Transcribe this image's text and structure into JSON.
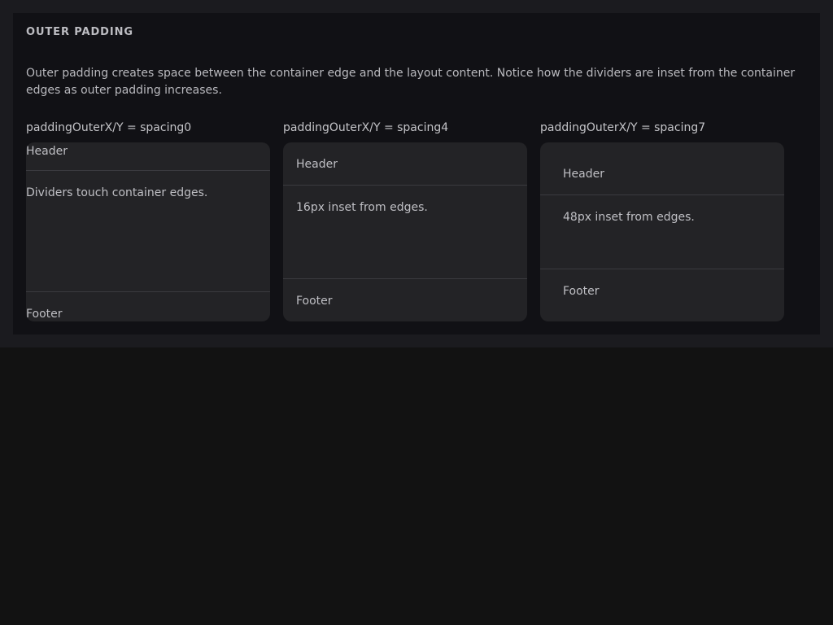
{
  "section": {
    "title": "OUTER PADDING",
    "description": "Outer padding creates space between the container edge and the layout content. Notice how the dividers are inset from the container edges as outer padding increases."
  },
  "columns": [
    {
      "label": "paddingOuterX/Y = spacing0",
      "header": "Header",
      "body": "Dividers touch container edges.",
      "footer": "Footer"
    },
    {
      "label": "paddingOuterX/Y = spacing4",
      "header": "Header",
      "body": "16px inset from edges.",
      "footer": "Footer"
    },
    {
      "label": "paddingOuterX/Y = spacing7",
      "header": "Header",
      "body": "48px inset from edges.",
      "footer": "Footer"
    }
  ]
}
